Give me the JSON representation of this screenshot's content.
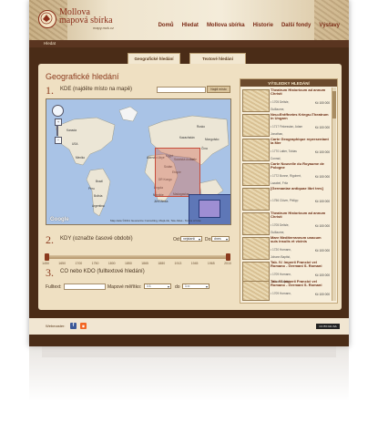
{
  "header": {
    "logo_line1": "Mollova",
    "logo_line2": "mapová sbírka",
    "logo_url": "mapy.mzk.cz",
    "nav": [
      "Domů",
      "Hledat",
      "Mollova sbírka",
      "Historie",
      "Další fondy",
      "Výstavy"
    ]
  },
  "breadcrumb": "Hledat",
  "tabs": {
    "geographic": "Geografické hledání",
    "text": "Textové hledání"
  },
  "page_title": "Geografické hledání",
  "step1": {
    "num": "1.",
    "label": "KDE (najděte místo na mapě)",
    "button": "Najdi místo"
  },
  "map": {
    "countries": [
      "Kanada",
      "USA",
      "Mexiko",
      "Brazil",
      "Peru",
      "Bolivia",
      "Argentina",
      "Rusko",
      "Čína",
      "Indie",
      "Mongolsko",
      "Kazachstán",
      "Saúdská Arábie",
      "Egypt",
      "Alžírsko",
      "Libye",
      "Súdán",
      "Etiopie",
      "DR Kongo",
      "Angola",
      "Namibie",
      "Jižní Afrika",
      "Madagaskar"
    ],
    "attribution": "Map data ©2011 Geocentre Consulting, MapLink, Tele Atlas - Terms of Use",
    "logo": "Google",
    "zoom_in": "+",
    "zoom_out": "−"
  },
  "step2": {
    "num": "2.",
    "label": "KDY (označte časové období)",
    "from_label": "Od:",
    "from_value": "nejstarší",
    "to_label": "Do:",
    "to_value": "dnes",
    "ticks": [
      "1450",
      "1650",
      "1700",
      "1750",
      "1800",
      "1850",
      "1865",
      "1880",
      "1913",
      "1945",
      "1965",
      "2010"
    ]
  },
  "step3": {
    "num": "3.",
    "label": "CO nebo KDO (fulltextové hledání)",
    "fulltext_label": "Fulltext:",
    "scale_label": "Mapové měřítko:",
    "scale_from": "1:1",
    "scale_to_label": "do",
    "scale_to": "1:∞"
  },
  "results": {
    "header": "VÝSLEDKY HLEDÁNÍ",
    "items": [
      {
        "title": "Theatrum Historicum ad annum Christi",
        "year": "• 1705 Delisle,",
        "price": "Kč 100 000",
        "seller": "Guillaume,"
      },
      {
        "title": "Neu=Entffnetes Kriegs=Theatrum in Ungarn",
        "year": "• 1717 Finkessian, Adam",
        "price": "Kč 100 000",
        "seller": "Jonathan,"
      },
      {
        "title": "Carte Geographique representant la Mer",
        "year": "• 1770 Latter, Tobias",
        "price": "Kč 100 000",
        "seller": "Conrad,"
      },
      {
        "title": "Carte Nouvelle du Royaume de Pologne",
        "year": "• 1772 Bonne, Rigobert,",
        "price": "Kč 100 000",
        "seller": "Lazabel, Fritz"
      },
      {
        "title": "[Germaniae antiquae libri tres]",
        "year": "• 1756 Clüver, Philipp",
        "price": "Kč 100 000",
        "seller": ""
      },
      {
        "title": "Theatrum Historicum ad annum Christi",
        "year": "• 1705 Delisle,",
        "price": "Kč 100 000",
        "seller": "Guillaume,"
      },
      {
        "title": "Mare Mediterraneum unacum suis insulis et vicinis",
        "year": "• 1720 Homann,",
        "price": "Kč 100 000",
        "seller": "Johann Baptist,"
      },
      {
        "title": "Tab. IV. Imperii Francici vel Romano - Germani S. Romani",
        "year": "• 1709 Homann,",
        "price": "Kč 100 000",
        "seller": "Johann Baptist,"
      },
      {
        "title": "Tab. IV. Imperii Francici vel Romano - Germani S. Romani",
        "year": "• 1709 Homann,",
        "price": "Kč 100 000",
        "seller": "Johann Baptist,"
      }
    ]
  },
  "footer": {
    "webmaster": "Webmaster:",
    "cc": "CC BY-NC-SA"
  }
}
